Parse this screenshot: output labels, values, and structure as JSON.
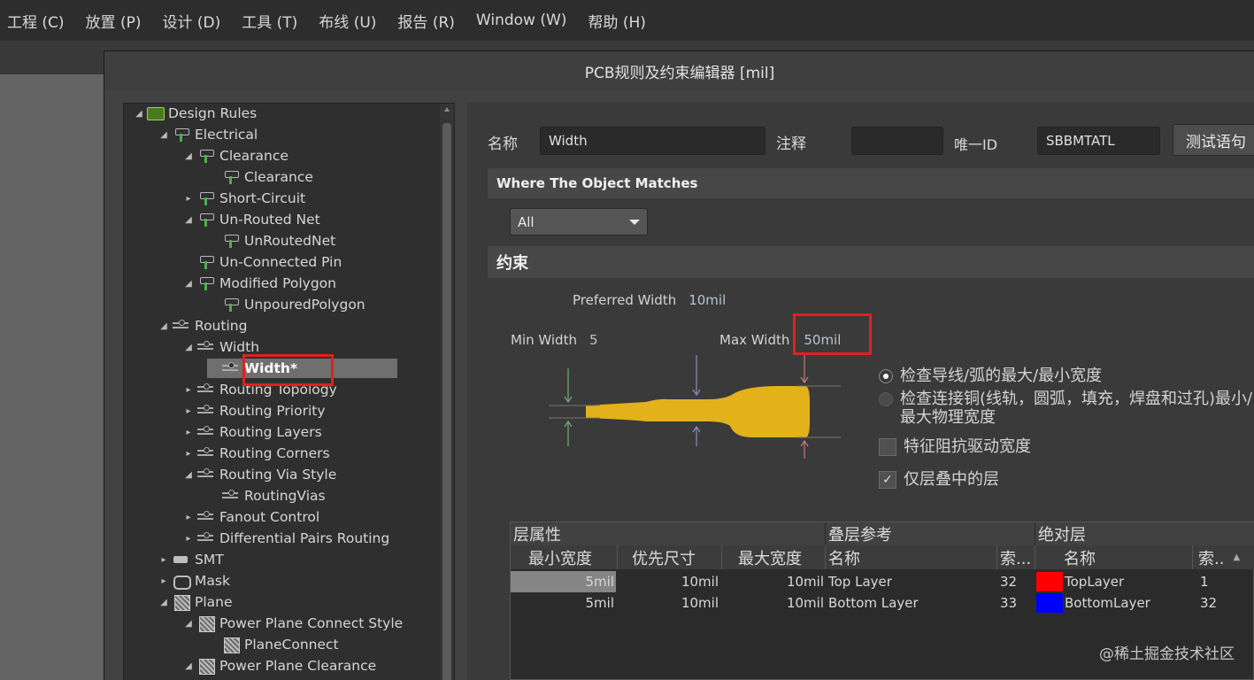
{
  "menu": [
    "工程 (C)",
    "放置 (P)",
    "设计 (D)",
    "工具 (T)",
    "布线 (U)",
    "报告 (R)",
    "Window (W)",
    "帮助 (H)"
  ],
  "dialog_title": "PCB规则及约束编辑器 [mil]",
  "tree": [
    {
      "label": "Design Rules",
      "toggle": "◢",
      "icon": "root"
    },
    {
      "label": "Electrical",
      "toggle": "◢",
      "icon": "rule"
    },
    {
      "label": "Clearance",
      "toggle": "◢",
      "icon": "rule"
    },
    {
      "label": "Clearance",
      "toggle": "",
      "icon": "rule"
    },
    {
      "label": "Short-Circuit",
      "toggle": "▸",
      "icon": "rule"
    },
    {
      "label": "Un-Routed Net",
      "toggle": "◢",
      "icon": "rule"
    },
    {
      "label": "UnRoutedNet",
      "toggle": "",
      "icon": "rule"
    },
    {
      "label": "Un-Connected Pin",
      "toggle": "",
      "icon": "rule"
    },
    {
      "label": "Modified Polygon",
      "toggle": "◢",
      "icon": "rule"
    },
    {
      "label": "UnpouredPolygon",
      "toggle": "",
      "icon": "rule"
    },
    {
      "label": "Routing",
      "toggle": "◢",
      "icon": "route"
    },
    {
      "label": "Width",
      "toggle": "◢",
      "icon": "route"
    },
    {
      "label": "Width*",
      "toggle": "",
      "icon": "route",
      "selected": true
    },
    {
      "label": "Routing Topology",
      "toggle": "▸",
      "icon": "route"
    },
    {
      "label": "Routing Priority",
      "toggle": "▸",
      "icon": "route"
    },
    {
      "label": "Routing Layers",
      "toggle": "▸",
      "icon": "route"
    },
    {
      "label": "Routing Corners",
      "toggle": "▸",
      "icon": "route"
    },
    {
      "label": "Routing Via Style",
      "toggle": "◢",
      "icon": "route"
    },
    {
      "label": "RoutingVias",
      "toggle": "",
      "icon": "route"
    },
    {
      "label": "Fanout Control",
      "toggle": "▸",
      "icon": "route"
    },
    {
      "label": "Differential Pairs Routing",
      "toggle": "▸",
      "icon": "route"
    },
    {
      "label": "SMT",
      "toggle": "▸",
      "icon": "smt"
    },
    {
      "label": "Mask",
      "toggle": "▸",
      "icon": "mask"
    },
    {
      "label": "Plane",
      "toggle": "◢",
      "icon": "plane"
    },
    {
      "label": "Power Plane Connect Style",
      "toggle": "◢",
      "icon": "plane"
    },
    {
      "label": "PlaneConnect",
      "toggle": "",
      "icon": "plane"
    },
    {
      "label": "Power Plane Clearance",
      "toggle": "◢",
      "icon": "plane"
    }
  ],
  "rule": {
    "name_label": "名称",
    "name_value": "Width",
    "comment_label": "注释",
    "comment_value": "",
    "id_label": "唯一ID",
    "id_value": "SBBMTATL",
    "test_button": "测试语句"
  },
  "where": {
    "heading": "Where The Object Matches",
    "scope": "All"
  },
  "constraints": {
    "heading": "约束",
    "preferred_label": "Preferred Width",
    "preferred_value": "10mil",
    "min_label": "Min Width",
    "min_value": "5",
    "max_label": "Max Width",
    "max_value": "50mil",
    "opt_check_track": "检查导线/弧的最大/最小宽度",
    "opt_check_copper": "检查连接铜(线轨，圆弧，填充，焊盘和过孔)最小/最大物理宽度",
    "opt_impedance": "特征阻抗驱动宽度",
    "opt_layer_stack": "仅层叠中的层"
  },
  "table": {
    "group_props": "层属性",
    "group_stack": "叠层参考",
    "group_abs": "绝对层",
    "col_min": "最小宽度",
    "col_pref": "优先尺寸",
    "col_max": "最大宽度",
    "col_name": "名称",
    "col_index": "索...",
    "col_abs_name": "名称",
    "col_abs_index": "索..",
    "rows": [
      {
        "min": "5mil",
        "pref": "10mil",
        "max": "10mil",
        "name": "Top Layer",
        "index": "32",
        "abs_color": "#ff0000",
        "abs_name": "TopLayer",
        "abs_index": "1"
      },
      {
        "min": "5mil",
        "pref": "10mil",
        "max": "10mil",
        "name": "Bottom Layer",
        "index": "33",
        "abs_color": "#0000ff",
        "abs_name": "BottomLayer",
        "abs_index": "32"
      }
    ]
  },
  "watermark": "@稀土掘金技术社区",
  "colors": {
    "trace": "#e3b21a",
    "highlight": "#e02020"
  }
}
